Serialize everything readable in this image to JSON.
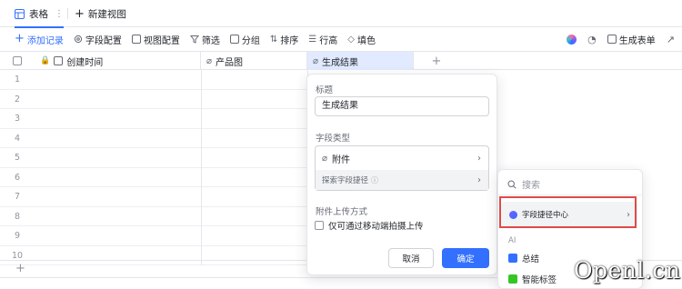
{
  "tabs": {
    "active_label": "表格",
    "more_label": "⋮",
    "new_view_label": "新建视图",
    "plus_label": "+"
  },
  "toolbar": {
    "add_record": "添加记录",
    "field_config": "字段配置",
    "view_config": "视图配置",
    "filter": "筛选",
    "group": "分组",
    "sort": "排序",
    "row_height": "行高",
    "fill": "填色",
    "generate_form": "生成表单"
  },
  "columns": {
    "created_time": "创建时间",
    "product_image": "产品图",
    "result": "生成结果",
    "add": "+"
  },
  "rows": [
    "1",
    "2",
    "3",
    "4",
    "5",
    "6",
    "7",
    "8",
    "9",
    "10"
  ],
  "add_row_label": "+",
  "field_popover": {
    "title_label": "标题",
    "title_value": "生成结果",
    "type_label": "字段类型",
    "type_value": "附件",
    "explore_label": "探索字段捷径",
    "info_icon": "ⓘ",
    "upload_label": "附件上传方式",
    "upload_option": "仅可通过移动端拍摄上传",
    "cancel": "取消",
    "confirm": "确定"
  },
  "shortcut_panel": {
    "search_placeholder": "搜索",
    "center_label": "字段捷径中心",
    "section_ai": "AI",
    "items": [
      "总结",
      "智能标签"
    ]
  },
  "watermark": "Openl.cn",
  "colors": {
    "accent": "#3370ff",
    "header_active": "#e1eaff",
    "highlight_border": "#e04a4a",
    "summary_icon": "#3370ff",
    "tag_icon": "#34c724"
  }
}
